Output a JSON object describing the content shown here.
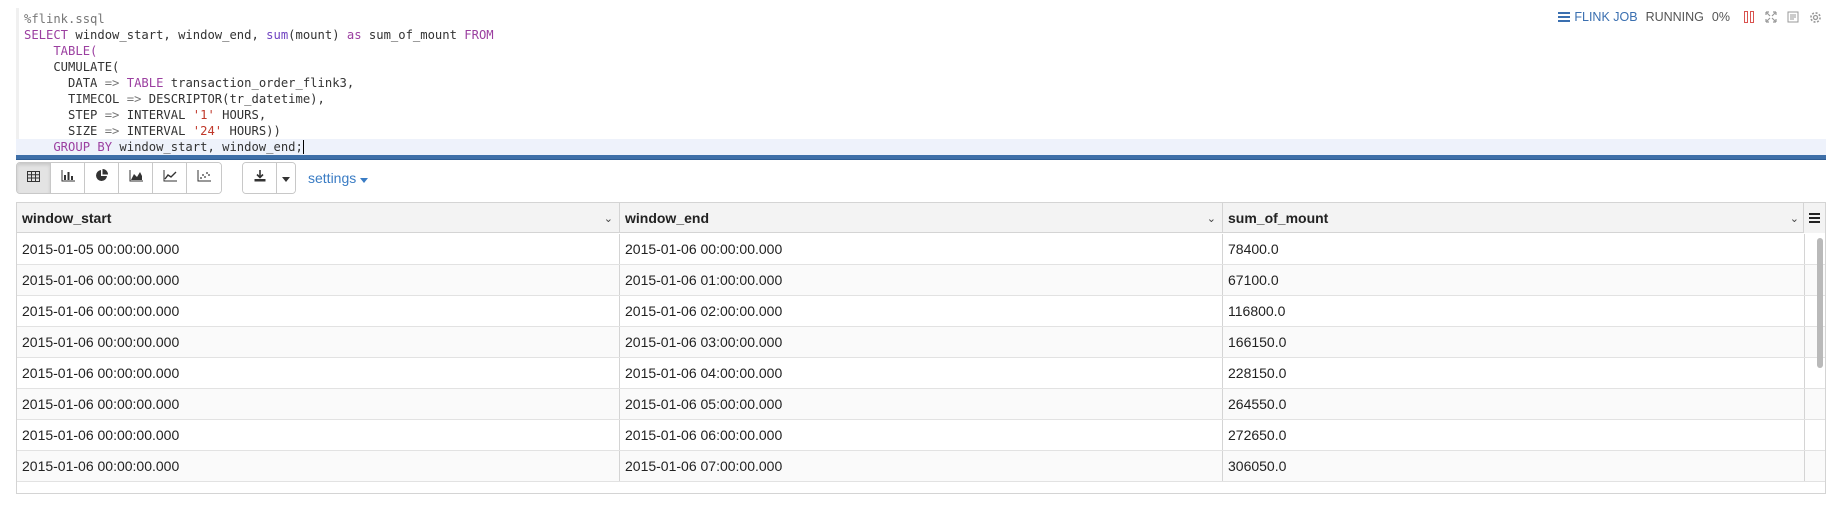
{
  "editor": {
    "lines": [
      [
        {
          "t": "%flink.ssql",
          "c": "op"
        }
      ],
      [
        {
          "t": "SELECT",
          "c": "kw"
        },
        {
          "t": " window_start, window_end, ",
          "c": ""
        },
        {
          "t": "sum",
          "c": "fn"
        },
        {
          "t": "(mount) ",
          "c": ""
        },
        {
          "t": "as",
          "c": "kw"
        },
        {
          "t": " sum_of_mount ",
          "c": ""
        },
        {
          "t": "FROM",
          "c": "kw"
        }
      ],
      [
        {
          "t": "    TABLE(",
          "c": "kw"
        }
      ],
      [
        {
          "t": "    CUMULATE(",
          "c": ""
        }
      ],
      [
        {
          "t": "      DATA ",
          "c": ""
        },
        {
          "t": "=>",
          "c": "op"
        },
        {
          "t": " TABLE",
          "c": "kw"
        },
        {
          "t": " transaction_order_flink3,",
          "c": ""
        }
      ],
      [
        {
          "t": "      TIMECOL ",
          "c": ""
        },
        {
          "t": "=>",
          "c": "op"
        },
        {
          "t": " DESCRIPTOR(tr_datetime),",
          "c": ""
        }
      ],
      [
        {
          "t": "      STEP ",
          "c": ""
        },
        {
          "t": "=>",
          "c": "op"
        },
        {
          "t": " INTERVAL ",
          "c": ""
        },
        {
          "t": "'1'",
          "c": "str"
        },
        {
          "t": " HOURS,",
          "c": ""
        }
      ],
      [
        {
          "t": "      SIZE ",
          "c": ""
        },
        {
          "t": "=>",
          "c": "op"
        },
        {
          "t": " INTERVAL ",
          "c": ""
        },
        {
          "t": "'24'",
          "c": "str"
        },
        {
          "t": " HOURS))",
          "c": ""
        }
      ],
      [
        {
          "t": "    GROUP BY",
          "c": "kw"
        },
        {
          "t": " window_start, window_end;",
          "c": ""
        }
      ]
    ]
  },
  "job": {
    "link_label": "FLINK JOB",
    "status": "RUNNING",
    "progress": "0%"
  },
  "toolbar": {
    "views": [
      "table-icon",
      "bar-chart-icon",
      "pie-chart-icon",
      "area-chart-icon",
      "line-chart-icon",
      "scatter-chart-icon"
    ],
    "settings_label": "settings"
  },
  "table": {
    "columns": [
      "window_start",
      "window_end",
      "sum_of_mount"
    ],
    "rows": [
      [
        "2015-01-05 00:00:00.000",
        "2015-01-06 00:00:00.000",
        "78400.0"
      ],
      [
        "2015-01-06 00:00:00.000",
        "2015-01-06 01:00:00.000",
        "67100.0"
      ],
      [
        "2015-01-06 00:00:00.000",
        "2015-01-06 02:00:00.000",
        "116800.0"
      ],
      [
        "2015-01-06 00:00:00.000",
        "2015-01-06 03:00:00.000",
        "166150.0"
      ],
      [
        "2015-01-06 00:00:00.000",
        "2015-01-06 04:00:00.000",
        "228150.0"
      ],
      [
        "2015-01-06 00:00:00.000",
        "2015-01-06 05:00:00.000",
        "264550.0"
      ],
      [
        "2015-01-06 00:00:00.000",
        "2015-01-06 06:00:00.000",
        "272650.0"
      ],
      [
        "2015-01-06 00:00:00.000",
        "2015-01-06 07:00:00.000",
        "306050.0"
      ]
    ]
  },
  "colors": {
    "accent": "#3a7cc4",
    "editor_divider": "#3e6fa8",
    "keyword": "#9b3fa0",
    "string": "#c0392b"
  }
}
